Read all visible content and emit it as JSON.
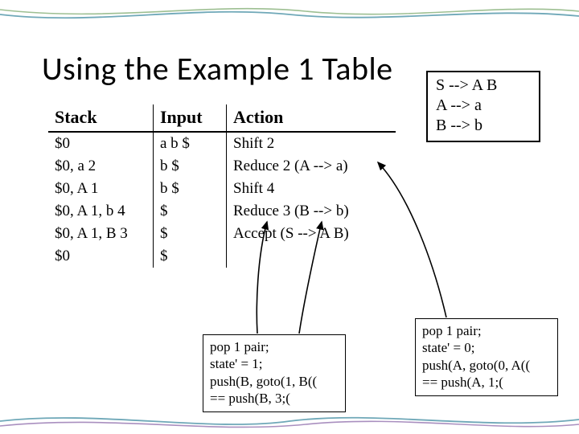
{
  "title": "Using the Example 1 Table",
  "table": {
    "headers": [
      "Stack",
      "Input",
      "Action"
    ],
    "rows": [
      {
        "stack": "$0",
        "input": "a b $",
        "action": "Shift 2"
      },
      {
        "stack": "$0, a 2",
        "input": "b $",
        "action": "Reduce 2  (A --> a)"
      },
      {
        "stack": "$0, A 1",
        "input": "b $",
        "action": "Shift 4"
      },
      {
        "stack": "$0, A 1, b 4",
        "input": "$",
        "action": "Reduce 3  (B --> b)"
      },
      {
        "stack": "$0, A 1, B 3",
        "input": "$",
        "action": "Accept  (S --> A B)"
      },
      {
        "stack": "$0",
        "input": "$",
        "action": ""
      }
    ]
  },
  "grammar": {
    "line1": "S --> A B",
    "line2": "A --> a",
    "line3": "B --> b"
  },
  "note_left": {
    "l1": "pop 1 pair;",
    "l2": "state' = 1;",
    "l3": "push(B, goto(1, B((",
    "l4": "  == push(B, 3;("
  },
  "note_right": {
    "l1": "pop 1 pair;",
    "l2": "state' = 0;",
    "l3": "push(A, goto(0, A((",
    "l4": "  == push(A, 1;("
  }
}
